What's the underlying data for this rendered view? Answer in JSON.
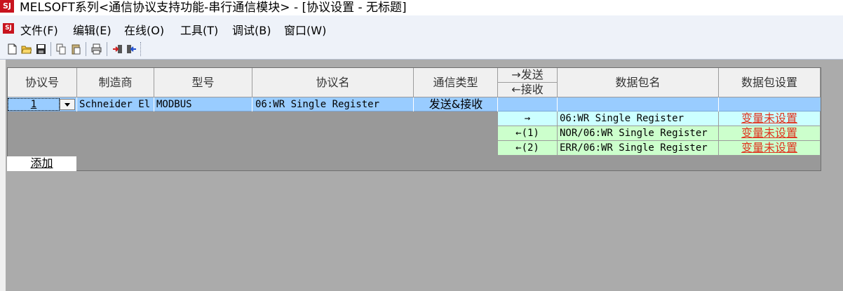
{
  "window": {
    "app_icon": "SJ",
    "title": "MELSOFT系列<通信协议支持功能-串行通信模块> - [协议设置 - 无标题]"
  },
  "menu": {
    "items": [
      "文件(F)",
      "编辑(E)",
      "在线(O)",
      "工具(T)",
      "调试(B)",
      "窗口(W)"
    ]
  },
  "toolbar": {
    "buttons": [
      "new-icon",
      "open-icon",
      "save-icon",
      "copy-icon",
      "paste-icon",
      "print-icon",
      "write-to-module-icon",
      "read-from-module-icon"
    ]
  },
  "table": {
    "headers": {
      "protocol_no": "协议号",
      "manufacturer": "制造商",
      "model": "型号",
      "protocol_name": "协议名",
      "comm_type": "通信类型",
      "send": "→发送",
      "receive": "←接收",
      "packet_name": "数据包名",
      "packet_setting": "数据包设置"
    },
    "row": {
      "protocol_no": "1",
      "manufacturer": "Schneider El",
      "model": "MODBUS",
      "protocol_name": "06:WR Single Register",
      "comm_type": "发送&接收"
    },
    "packets": [
      {
        "direction": "→",
        "name": "06:WR Single Register",
        "setting": "变量未设置"
      },
      {
        "direction": "←(1)",
        "name": "NOR/06:WR Single Register",
        "setting": "变量未设置"
      },
      {
        "direction": "←(2)",
        "name": "ERR/06:WR Single Register",
        "setting": "变量未设置"
      }
    ],
    "add_label": "添加"
  },
  "colors": {
    "selected_row": "#99ccff",
    "send_packet_bg": "#ccffff",
    "receive_packet_bg": "#ccffcc",
    "unset_link": "#e0321e"
  }
}
